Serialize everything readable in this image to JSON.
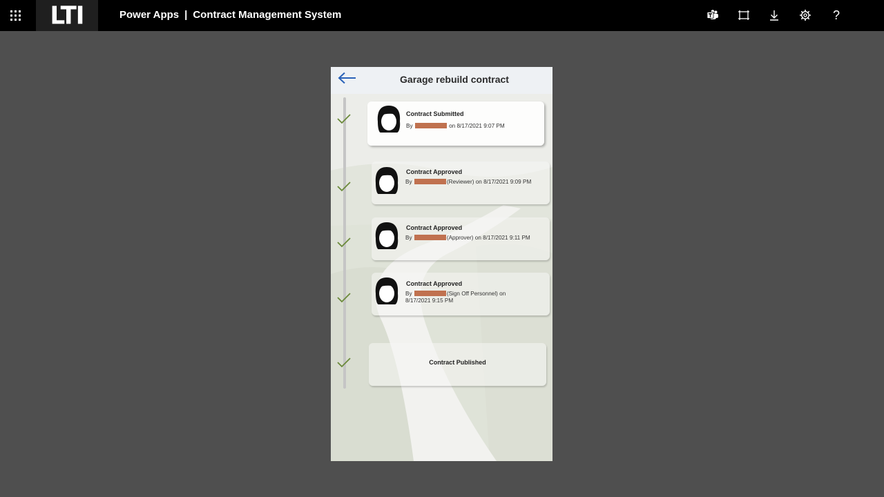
{
  "topbar": {
    "logo": "LTI",
    "product": "Power Apps",
    "separator": "|",
    "app_name": "Contract Management System",
    "icons": [
      "teams-icon",
      "fit-to-screen-icon",
      "download-icon",
      "settings-icon",
      "help-icon"
    ],
    "help_glyph": "?"
  },
  "screen": {
    "title": "Garage rebuild contract"
  },
  "timeline": [
    {
      "title": "Contract Submitted",
      "by": "By",
      "detail": "on 8/17/2021 9:07 PM"
    },
    {
      "title": "Contract Approved",
      "by": "By",
      "detail": "(Reviewer) on 8/17/2021 9:09 PM"
    },
    {
      "title": "Contract Approved",
      "by": "By",
      "detail": "(Approver) on 8/17/2021 9:11 PM"
    },
    {
      "title": "Contract Approved",
      "by": "By",
      "detail": "(Sign Off Personnel) on 8/17/2021 9:15 PM"
    },
    {
      "title": "Contract Published"
    }
  ],
  "colors": {
    "topbar": "#000000",
    "page_bg": "#4f4f4f",
    "check": "#6b8a3a",
    "back_arrow": "#2a62b8",
    "redaction": "#c0714f"
  }
}
